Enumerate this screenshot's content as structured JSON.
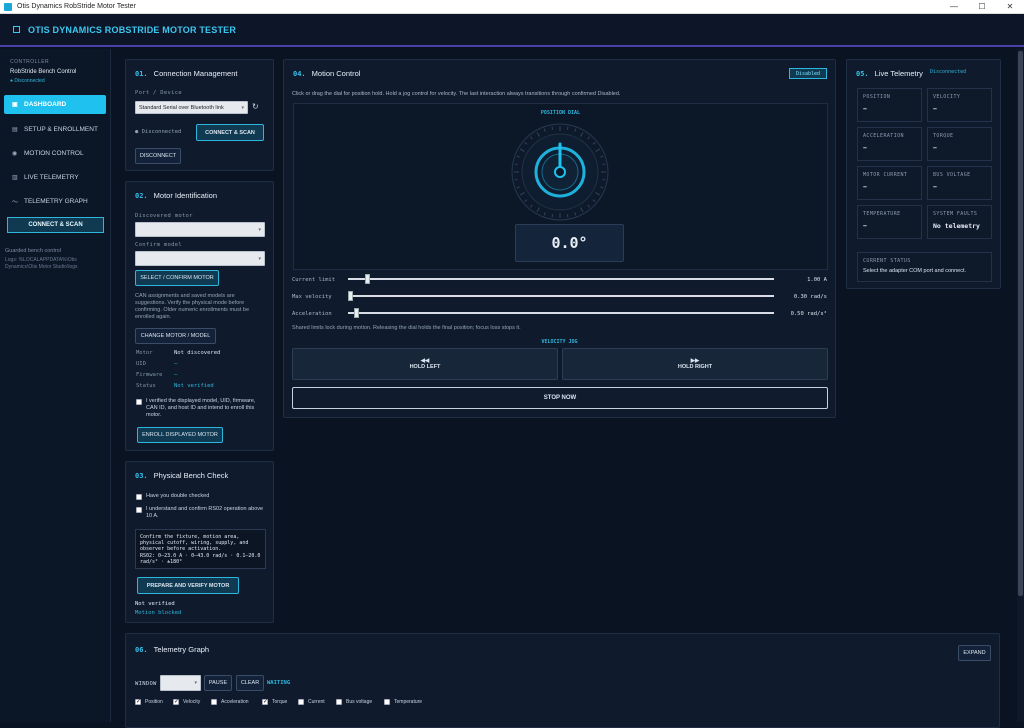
{
  "window": {
    "title": "Otis Dynamics RobStride Motor Tester",
    "controls": [
      "—",
      "☐",
      "✕"
    ]
  },
  "header": {
    "title": "OTIS DYNAMICS ROBSTRIDE MOTOR TESTER"
  },
  "sidebar": {
    "controller_label": "CONTROLLER",
    "controller_name": "RobStride Bench Control",
    "controller_status": "● Disconnected",
    "items": [
      {
        "label": "DASHBOARD",
        "icon": "▣"
      },
      {
        "label": "SETUP & ENROLLMENT",
        "icon": "▤"
      },
      {
        "label": "MOTION CONTROL",
        "icon": "◉"
      },
      {
        "label": "LIVE TELEMETRY",
        "icon": "▥"
      },
      {
        "label": "TELEMETRY GRAPH",
        "icon": "〜"
      }
    ],
    "connect_button": "CONNECT & SCAN",
    "guarded_label": "Guarded bench control",
    "logs_path": "Logs: %LOCALAPPDATA%\\Otis Dynamics\\Otis Motor Studio\\logs"
  },
  "connection": {
    "number": "01.",
    "title": "Connection Management",
    "port_label": "Port / Device",
    "port_value": "Standard Serial over Bluetooth link",
    "refresh_icon": "↻",
    "status": "● Disconnected",
    "connect_button": "CONNECT & SCAN",
    "disconnect_button": "DISCONNECT"
  },
  "motor_id": {
    "number": "02.",
    "title": "Motor Identification",
    "discovered_label": "Discovered motor",
    "confirm_label": "Confirm model",
    "select_button": "SELECT / CONFIRM MOTOR",
    "note": "CAN assignments and saved models are suggestions. Verify the physical mode before confirming. Older numeric enrollments must be enrolled again.",
    "change_button": "CHANGE MOTOR / MODEL",
    "fields": [
      {
        "key": "Motor",
        "value": "Not discovered"
      },
      {
        "key": "UID",
        "value": "–"
      },
      {
        "key": "Firmware",
        "value": "–"
      },
      {
        "key": "Status",
        "value": "Not verified"
      }
    ],
    "verify_text": "I verified the displayed model, UID, firmware, CAN ID, and host ID and intend to enroll this motor.",
    "enroll_button": "ENROLL DISPLAYED MOTOR"
  },
  "bench": {
    "number": "03.",
    "title": "Physical Bench Check",
    "check1": "Have you double checked",
    "check2": "I understand and confirm RS02 operation above 10 A.",
    "notice": "Confirm the fixture, motion area, physical cutoff, wiring, supply, and observer before activation.",
    "limits": "RS02: 0–23.0 A · 0–43.0 rad/s · 0.1–20.0 rad/s² · ±180°",
    "prepare_button": "PREPARE AND VERIFY MOTOR",
    "status1": "Not verified",
    "status2": "Motion blocked"
  },
  "motion": {
    "number": "04.",
    "title": "Motion Control",
    "badge": "Disabled",
    "hint": "Click or drag the dial for position hold. Hold a jog control for velocity. The last interaction always transitions through confirmed Disabled.",
    "dial_label": "POSITION DIAL",
    "dial_value": "0.0°",
    "sliders": [
      {
        "label": "Current limit",
        "value": "1.00 A",
        "fraction": 0.04
      },
      {
        "label": "Max velocity",
        "value": "0.30 rad/s",
        "fraction": 0.0
      },
      {
        "label": "Acceleration",
        "value": "0.50 rad/s²",
        "fraction": 0.015
      }
    ],
    "shared_note": "Shared limits lock during motion. Releasing the dial holds the final position; focus loss stops it.",
    "jog_label": "VELOCITY JOG",
    "hold_left_icon": "◀◀",
    "hold_left": "HOLD LEFT",
    "hold_right_icon": "▶▶",
    "hold_right": "HOLD RIGHT",
    "stop_button": "STOP NOW"
  },
  "telemetry": {
    "number": "05.",
    "title": "Live Telemetry",
    "badge": "Disconnected",
    "cards": [
      {
        "label": "POSITION",
        "value": "–"
      },
      {
        "label": "VELOCITY",
        "value": "–"
      },
      {
        "label": "ACCELERATION",
        "value": "–"
      },
      {
        "label": "TORQUE",
        "value": "–"
      },
      {
        "label": "MOTOR CURRENT",
        "value": "–"
      },
      {
        "label": "BUS VOLTAGE",
        "value": "–"
      },
      {
        "label": "TEMPERATURE",
        "value": "–"
      },
      {
        "label": "SYSTEM FAULTS",
        "value": "No telemetry"
      }
    ],
    "current_status_label": "CURRENT STATUS",
    "current_status_text": "Select the adapter COM port and connect."
  },
  "graph": {
    "number": "06.",
    "title": "Telemetry Graph",
    "expand_button": "EXPAND",
    "window_label": "WINDOW",
    "window_value": "",
    "pause_button": "PAUSE",
    "clear_button": "CLEAR",
    "state": "WAITING",
    "series": [
      {
        "label": "Position",
        "checked": true
      },
      {
        "label": "Velocity",
        "checked": true
      },
      {
        "label": "Acceleration",
        "checked": false
      },
      {
        "label": "Torque",
        "checked": true
      },
      {
        "label": "Current",
        "checked": false
      },
      {
        "label": "Bus voltage",
        "checked": false
      },
      {
        "label": "Temperature",
        "checked": false
      }
    ]
  },
  "colors": {
    "accent": "#1fc2ee",
    "background": "#0a1322",
    "panel": "#0f1b2d",
    "header_rule": "#4b3fa8"
  }
}
